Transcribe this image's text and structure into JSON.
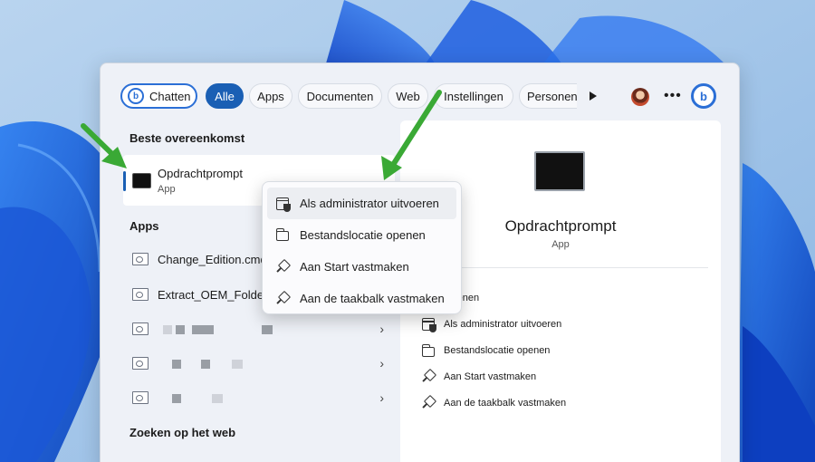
{
  "tabs": [
    {
      "id": "chat",
      "label": "Chatten",
      "icon": "bing-icon"
    },
    {
      "id": "all",
      "label": "Alle",
      "active": true
    },
    {
      "id": "apps",
      "label": "Apps"
    },
    {
      "id": "documents",
      "label": "Documenten"
    },
    {
      "id": "web",
      "label": "Web"
    },
    {
      "id": "settings",
      "label": "Instellingen"
    },
    {
      "id": "people",
      "label": "Personen"
    }
  ],
  "header_icons": [
    "play-icon",
    "user-avatar",
    "more-icon",
    "bing-icon"
  ],
  "best_match": {
    "section_title": "Beste overeenkomst",
    "name": "Opdrachtprompt",
    "type": "App",
    "icon": "command-prompt-icon"
  },
  "apps": {
    "section_title": "Apps",
    "items": [
      {
        "label": "Change_Edition.cmd",
        "icon": "file-icon"
      },
      {
        "label": "Extract_OEM_Folder.cmd",
        "icon": "file-icon"
      },
      {
        "label": "",
        "icon": "file-icon",
        "blurred": true
      },
      {
        "label": "",
        "icon": "file-icon",
        "blurred": true
      },
      {
        "label": "",
        "icon": "file-icon",
        "blurred": true
      }
    ]
  },
  "web_section_title": "Zoeken op het web",
  "details": {
    "title": "Opdrachtprompt",
    "subtitle": "App",
    "actions": [
      {
        "label": "Openen",
        "icon": "open-icon"
      },
      {
        "label": "Als administrator uitvoeren",
        "icon": "admin-shield-icon"
      },
      {
        "label": "Bestandslocatie openen",
        "icon": "folder-icon"
      },
      {
        "label": "Aan Start vastmaken",
        "icon": "pin-icon"
      },
      {
        "label": "Aan de taakbalk vastmaken",
        "icon": "pin-icon"
      }
    ]
  },
  "context_menu": {
    "items": [
      {
        "label": "Als administrator uitvoeren",
        "icon": "admin-shield-icon",
        "highlighted": true
      },
      {
        "label": "Bestandslocatie openen",
        "icon": "folder-icon"
      },
      {
        "label": "Aan Start vastmaken",
        "icon": "pin-icon"
      },
      {
        "label": "Aan de taakbalk vastmaken",
        "icon": "pin-icon"
      }
    ]
  },
  "colors": {
    "accent": "#1a5fb4",
    "annotation_arrow": "#3aa935",
    "wallpaper": "#9fc4ea"
  }
}
